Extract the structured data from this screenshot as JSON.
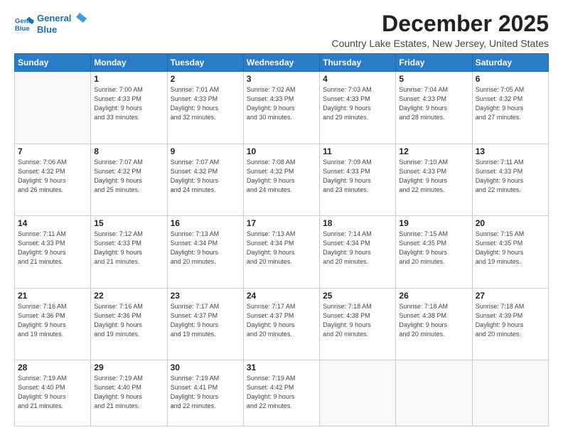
{
  "header": {
    "logo_line1": "General",
    "logo_line2": "Blue",
    "month_title": "December 2025",
    "location": "Country Lake Estates, New Jersey, United States"
  },
  "days_of_week": [
    "Sunday",
    "Monday",
    "Tuesday",
    "Wednesday",
    "Thursday",
    "Friday",
    "Saturday"
  ],
  "weeks": [
    [
      {
        "num": "",
        "info": ""
      },
      {
        "num": "1",
        "info": "Sunrise: 7:00 AM\nSunset: 4:33 PM\nDaylight: 9 hours\nand 33 minutes."
      },
      {
        "num": "2",
        "info": "Sunrise: 7:01 AM\nSunset: 4:33 PM\nDaylight: 9 hours\nand 32 minutes."
      },
      {
        "num": "3",
        "info": "Sunrise: 7:02 AM\nSunset: 4:33 PM\nDaylight: 9 hours\nand 30 minutes."
      },
      {
        "num": "4",
        "info": "Sunrise: 7:03 AM\nSunset: 4:33 PM\nDaylight: 9 hours\nand 29 minutes."
      },
      {
        "num": "5",
        "info": "Sunrise: 7:04 AM\nSunset: 4:33 PM\nDaylight: 9 hours\nand 28 minutes."
      },
      {
        "num": "6",
        "info": "Sunrise: 7:05 AM\nSunset: 4:32 PM\nDaylight: 9 hours\nand 27 minutes."
      }
    ],
    [
      {
        "num": "7",
        "info": "Sunrise: 7:06 AM\nSunset: 4:32 PM\nDaylight: 9 hours\nand 26 minutes."
      },
      {
        "num": "8",
        "info": "Sunrise: 7:07 AM\nSunset: 4:32 PM\nDaylight: 9 hours\nand 25 minutes."
      },
      {
        "num": "9",
        "info": "Sunrise: 7:07 AM\nSunset: 4:32 PM\nDaylight: 9 hours\nand 24 minutes."
      },
      {
        "num": "10",
        "info": "Sunrise: 7:08 AM\nSunset: 4:32 PM\nDaylight: 9 hours\nand 24 minutes."
      },
      {
        "num": "11",
        "info": "Sunrise: 7:09 AM\nSunset: 4:33 PM\nDaylight: 9 hours\nand 23 minutes."
      },
      {
        "num": "12",
        "info": "Sunrise: 7:10 AM\nSunset: 4:33 PM\nDaylight: 9 hours\nand 22 minutes."
      },
      {
        "num": "13",
        "info": "Sunrise: 7:11 AM\nSunset: 4:33 PM\nDaylight: 9 hours\nand 22 minutes."
      }
    ],
    [
      {
        "num": "14",
        "info": "Sunrise: 7:11 AM\nSunset: 4:33 PM\nDaylight: 9 hours\nand 21 minutes."
      },
      {
        "num": "15",
        "info": "Sunrise: 7:12 AM\nSunset: 4:33 PM\nDaylight: 9 hours\nand 21 minutes."
      },
      {
        "num": "16",
        "info": "Sunrise: 7:13 AM\nSunset: 4:34 PM\nDaylight: 9 hours\nand 20 minutes."
      },
      {
        "num": "17",
        "info": "Sunrise: 7:13 AM\nSunset: 4:34 PM\nDaylight: 9 hours\nand 20 minutes."
      },
      {
        "num": "18",
        "info": "Sunrise: 7:14 AM\nSunset: 4:34 PM\nDaylight: 9 hours\nand 20 minutes."
      },
      {
        "num": "19",
        "info": "Sunrise: 7:15 AM\nSunset: 4:35 PM\nDaylight: 9 hours\nand 20 minutes."
      },
      {
        "num": "20",
        "info": "Sunrise: 7:15 AM\nSunset: 4:35 PM\nDaylight: 9 hours\nand 19 minutes."
      }
    ],
    [
      {
        "num": "21",
        "info": "Sunrise: 7:16 AM\nSunset: 4:36 PM\nDaylight: 9 hours\nand 19 minutes."
      },
      {
        "num": "22",
        "info": "Sunrise: 7:16 AM\nSunset: 4:36 PM\nDaylight: 9 hours\nand 19 minutes."
      },
      {
        "num": "23",
        "info": "Sunrise: 7:17 AM\nSunset: 4:37 PM\nDaylight: 9 hours\nand 19 minutes."
      },
      {
        "num": "24",
        "info": "Sunrise: 7:17 AM\nSunset: 4:37 PM\nDaylight: 9 hours\nand 20 minutes."
      },
      {
        "num": "25",
        "info": "Sunrise: 7:18 AM\nSunset: 4:38 PM\nDaylight: 9 hours\nand 20 minutes."
      },
      {
        "num": "26",
        "info": "Sunrise: 7:18 AM\nSunset: 4:38 PM\nDaylight: 9 hours\nand 20 minutes."
      },
      {
        "num": "27",
        "info": "Sunrise: 7:18 AM\nSunset: 4:39 PM\nDaylight: 9 hours\nand 20 minutes."
      }
    ],
    [
      {
        "num": "28",
        "info": "Sunrise: 7:19 AM\nSunset: 4:40 PM\nDaylight: 9 hours\nand 21 minutes."
      },
      {
        "num": "29",
        "info": "Sunrise: 7:19 AM\nSunset: 4:40 PM\nDaylight: 9 hours\nand 21 minutes."
      },
      {
        "num": "30",
        "info": "Sunrise: 7:19 AM\nSunset: 4:41 PM\nDaylight: 9 hours\nand 22 minutes."
      },
      {
        "num": "31",
        "info": "Sunrise: 7:19 AM\nSunset: 4:42 PM\nDaylight: 9 hours\nand 22 minutes."
      },
      {
        "num": "",
        "info": ""
      },
      {
        "num": "",
        "info": ""
      },
      {
        "num": "",
        "info": ""
      }
    ]
  ]
}
